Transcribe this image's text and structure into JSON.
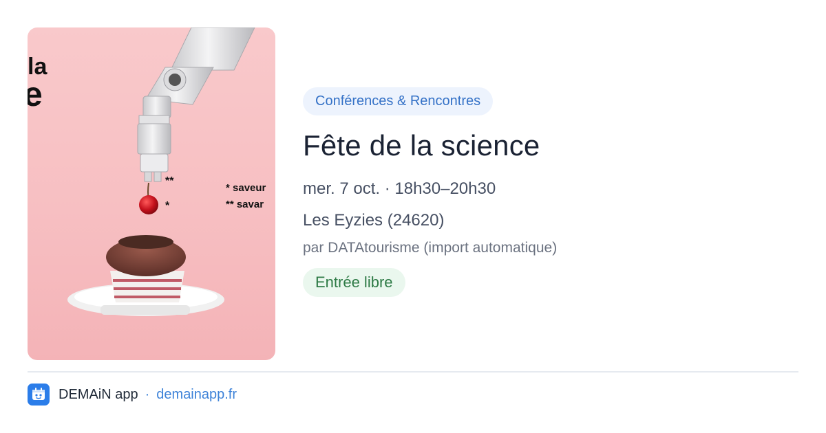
{
  "poster": {
    "text_la": "la",
    "text_e": "e",
    "star_double": "**",
    "star_single": "*",
    "legend_line1": "* saveur",
    "legend_line2": "** savar"
  },
  "event": {
    "category": "Conférences & Rencontres",
    "title": "Fête de la science",
    "datetime": "mer. 7 oct. · 18h30–20h30",
    "place": "Les Eyzies (24620)",
    "author": "par DATAtourisme (import automatique)",
    "price": "Entrée libre"
  },
  "footer": {
    "app_name": "DEMAiN app",
    "separator": "·",
    "link": "demainapp.fr"
  },
  "colors": {
    "accent": "#3572c7",
    "price_green": "#2d7a45",
    "poster_pink": "#f7bfc2",
    "app_icon_blue": "#2b7de9"
  },
  "icons": {
    "app": "demain-app-icon"
  }
}
